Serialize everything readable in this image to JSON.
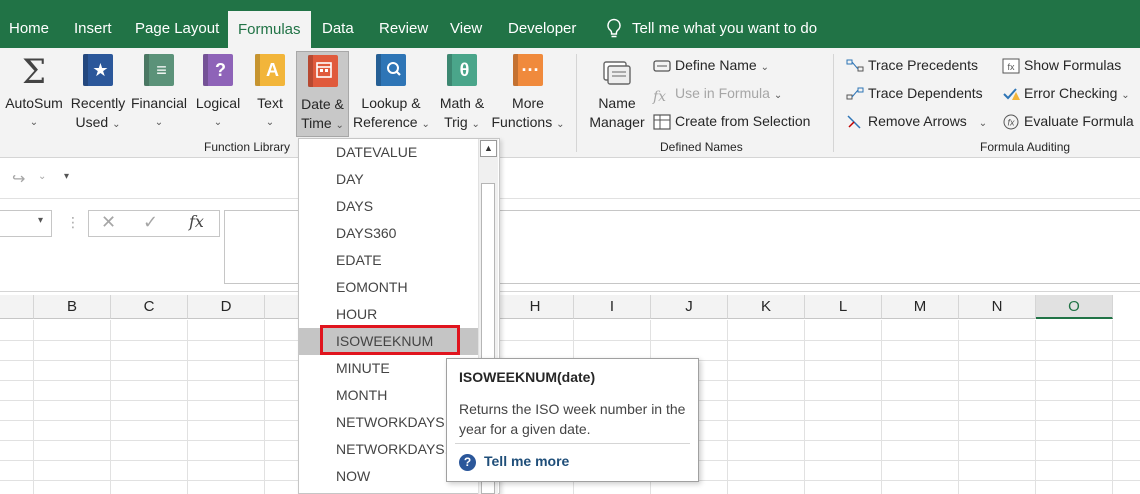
{
  "colors": {
    "brand_green": "#217346",
    "highlight_red": "#e0141e"
  },
  "menu": {
    "tabs": [
      {
        "label": "Home"
      },
      {
        "label": "Insert"
      },
      {
        "label": "Page Layout"
      },
      {
        "label": "Formulas"
      },
      {
        "label": "Data"
      },
      {
        "label": "Review"
      },
      {
        "label": "View"
      },
      {
        "label": "Developer"
      }
    ],
    "active_tab": "Formulas",
    "tell_me": "Tell me what you want to do"
  },
  "ribbon": {
    "function_library": {
      "autosum": "AutoSum",
      "recently_used": [
        "Recently",
        "Used"
      ],
      "financial": "Financial",
      "logical": "Logical",
      "text": "Text",
      "date_time": [
        "Date &",
        "Time"
      ],
      "lookup": [
        "Lookup &",
        "Reference"
      ],
      "math": [
        "Math &",
        "Trig"
      ],
      "more": [
        "More",
        "Functions"
      ],
      "group_label": "Function Library"
    },
    "defined_names": {
      "name_manager": [
        "Name",
        "Manager"
      ],
      "define_name": "Define Name",
      "use_in_formula": "Use in Formula",
      "create_from_selection": "Create from Selection",
      "group_label": "Defined Names"
    },
    "formula_auditing": {
      "trace_precedents": "Trace Precedents",
      "trace_dependents": "Trace Dependents",
      "remove_arrows": "Remove Arrows",
      "show_formulas": "Show Formulas",
      "error_checking": "Error Checking",
      "evaluate_formula": "Evaluate Formula",
      "group_label": "Formula Auditing"
    }
  },
  "formula_bar": {
    "fx_label": "fx"
  },
  "columns": [
    "B",
    "C",
    "D",
    "H",
    "I",
    "J",
    "K",
    "L",
    "M",
    "N",
    "O"
  ],
  "dropdown": {
    "items": [
      "DATEVALUE",
      "DAY",
      "DAYS",
      "DAYS360",
      "EDATE",
      "EOMONTH",
      "HOUR",
      "ISOWEEKNUM",
      "MINUTE",
      "MONTH",
      "NETWORKDAYS",
      "NETWORKDAYS.INTL",
      "NOW"
    ],
    "highlighted": "ISOWEEKNUM"
  },
  "tooltip": {
    "title": "ISOWEEKNUM(date)",
    "description": "Returns the ISO week number in the year for a given date.",
    "link": "Tell me more"
  }
}
